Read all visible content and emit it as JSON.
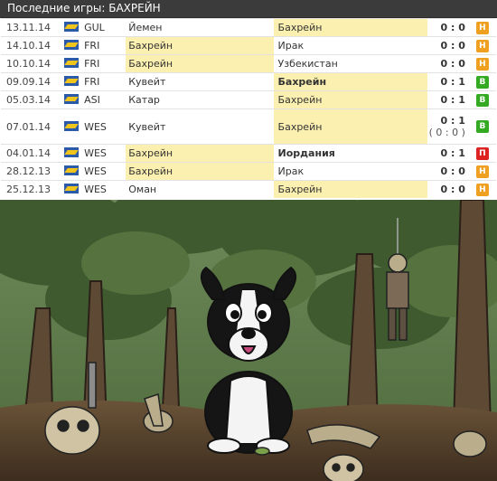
{
  "header": {
    "title": "Последние игры: БАХРЕЙН"
  },
  "matches": [
    {
      "date": "13.11.14",
      "tour": "GUL",
      "home": "Йемен",
      "away": "Бахрейн",
      "score": "0 : 0",
      "res": "Н",
      "res_color": "#f0a020",
      "hl": "away",
      "bold": ""
    },
    {
      "date": "14.10.14",
      "tour": "FRI",
      "home": "Бахрейн",
      "away": "Ирак",
      "score": "0 : 0",
      "res": "Н",
      "res_color": "#f0a020",
      "hl": "home",
      "bold": ""
    },
    {
      "date": "10.10.14",
      "tour": "FRI",
      "home": "Бахрейн",
      "away": "Узбекистан",
      "score": "0 : 0",
      "res": "Н",
      "res_color": "#f0a020",
      "hl": "home",
      "bold": ""
    },
    {
      "date": "09.09.14",
      "tour": "FRI",
      "home": "Кувейт",
      "away": "Бахрейн",
      "score": "0 : 1",
      "res": "В",
      "res_color": "#33aa22",
      "hl": "away",
      "bold": "away"
    },
    {
      "date": "05.03.14",
      "tour": "ASI",
      "home": "Катар",
      "away": "Бахрейн",
      "score": "0 : 1",
      "res": "В",
      "res_color": "#33aa22",
      "hl": "away",
      "bold": ""
    },
    {
      "date": "07.01.14",
      "tour": "WES",
      "home": "Кувейт",
      "away": "Бахрейн",
      "score": "0 : 1",
      "score_sub": "( 0 : 0 )",
      "res": "В",
      "res_color": "#33aa22",
      "hl": "away",
      "bold": ""
    },
    {
      "date": "04.01.14",
      "tour": "WES",
      "home": "Бахрейн",
      "away": "Иордания",
      "score": "0 : 1",
      "res": "П",
      "res_color": "#dd2222",
      "hl": "home",
      "bold": "away"
    },
    {
      "date": "28.12.13",
      "tour": "WES",
      "home": "Бахрейн",
      "away": "Ирак",
      "score": "0 : 0",
      "res": "Н",
      "res_color": "#f0a020",
      "hl": "home",
      "bold": ""
    },
    {
      "date": "25.12.13",
      "tour": "WES",
      "home": "Оман",
      "away": "Бахрейн",
      "score": "0 : 0",
      "res": "Н",
      "res_color": "#f0a020",
      "hl": "away",
      "bold": ""
    }
  ],
  "image": {
    "alt": "cartoon dog sitting in a forest surrounded by zombies"
  }
}
